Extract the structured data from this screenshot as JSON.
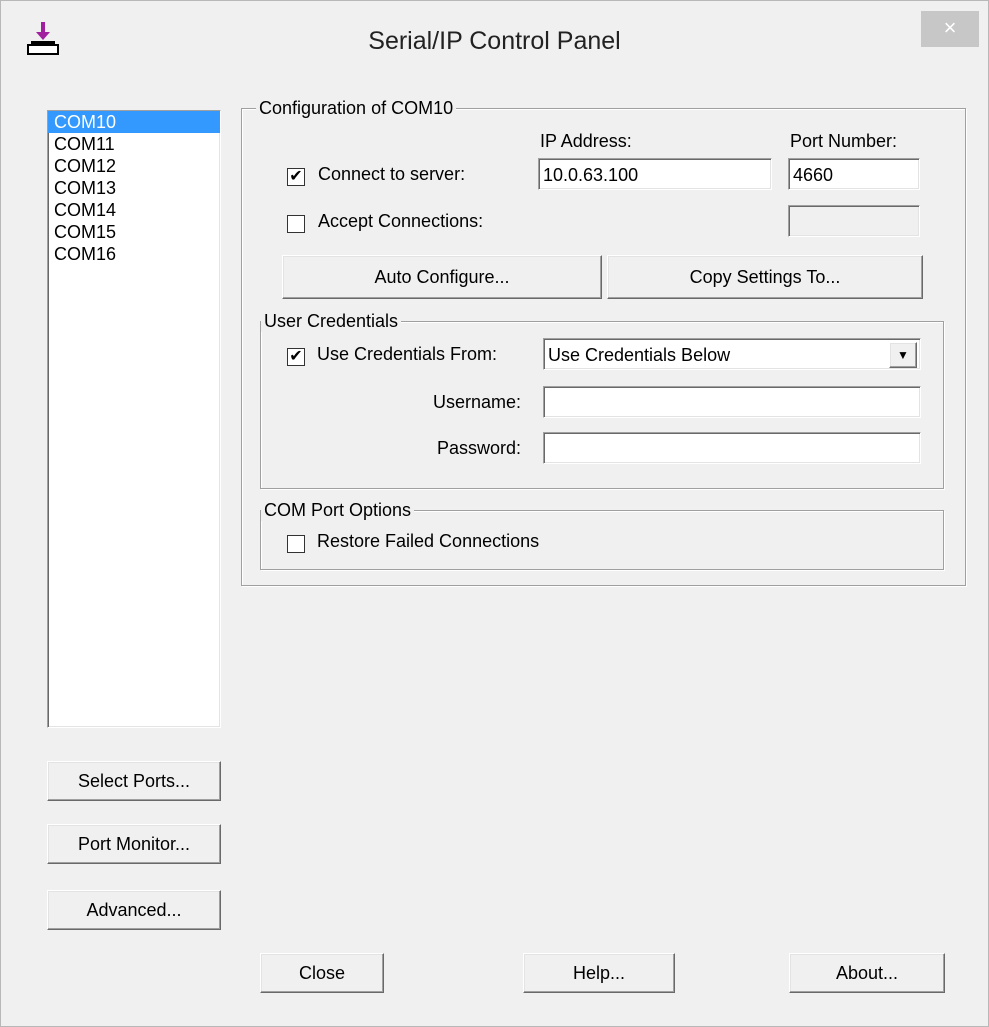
{
  "window": {
    "title": "Serial/IP Control Panel",
    "close_glyph": "×"
  },
  "ports": {
    "items": [
      "COM10",
      "COM11",
      "COM12",
      "COM13",
      "COM14",
      "COM15",
      "COM16"
    ],
    "selected": "COM10"
  },
  "left_buttons": {
    "select_ports": "Select Ports...",
    "port_monitor": "Port Monitor...",
    "advanced": "Advanced..."
  },
  "config": {
    "group_title": "Configuration of COM10",
    "ip_address_label": "IP Address:",
    "port_number_label": "Port Number:",
    "connect_to_server_label": "Connect to server:",
    "connect_to_server_checked": true,
    "ip_address_value": "10.0.63.100",
    "port_number_value": "4660",
    "accept_connections_label": "Accept Connections:",
    "accept_connections_checked": false,
    "accept_port_value": "",
    "auto_configure_label": "Auto Configure...",
    "copy_settings_label": "Copy Settings To..."
  },
  "credentials": {
    "group_title": "User Credentials",
    "use_credentials_label": "Use Credentials From:",
    "use_credentials_checked": true,
    "credentials_source": "Use Credentials Below",
    "username_label": "Username:",
    "username_value": "",
    "password_label": "Password:",
    "password_value": ""
  },
  "com_options": {
    "group_title": "COM Port Options",
    "restore_label": "Restore Failed Connections",
    "restore_checked": false
  },
  "bottom_buttons": {
    "close": "Close",
    "help": "Help...",
    "about": "About..."
  },
  "glyphs": {
    "check": "✔",
    "dropdown": "▼"
  },
  "icons": {
    "app": "serial-ip-plug-icon",
    "close": "close-icon"
  }
}
